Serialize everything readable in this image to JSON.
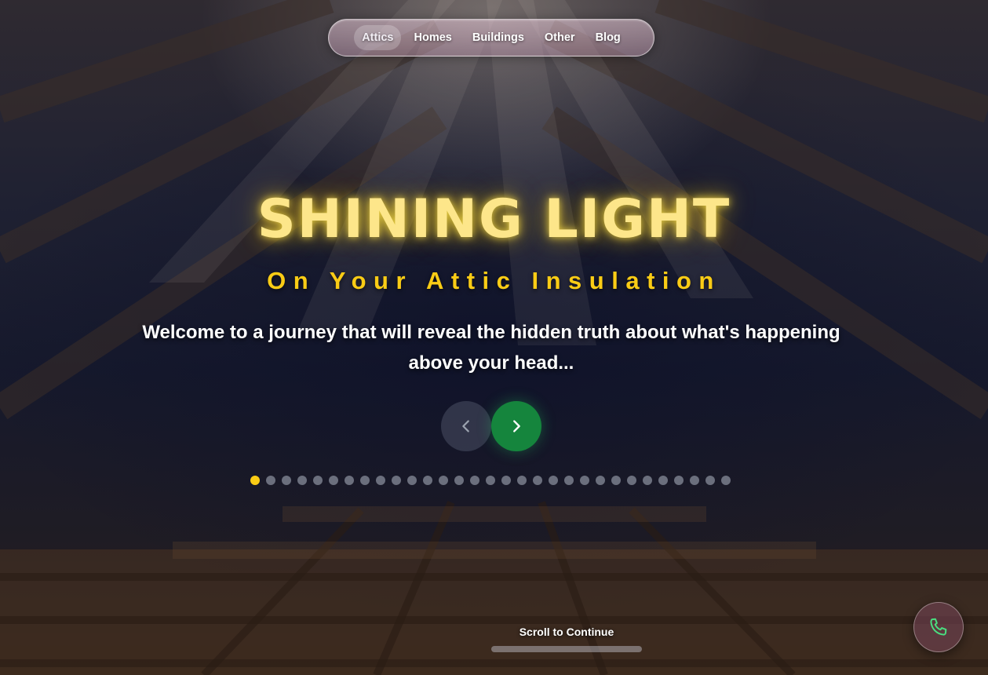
{
  "nav": {
    "items": [
      {
        "label": "Attics",
        "active": true
      },
      {
        "label": "Homes",
        "active": false
      },
      {
        "label": "Buildings",
        "active": false
      },
      {
        "label": "Other",
        "active": false
      },
      {
        "label": "Blog",
        "active": false
      }
    ]
  },
  "hero": {
    "title": "SHINING LIGHT",
    "subtitle": "On Your Attic Insulation",
    "text": "Welcome to a journey that will reveal the hidden truth about what's happening above your head...",
    "slide_current": 1,
    "slide_total": 31
  },
  "icons": {
    "prev": "chevron-left-icon",
    "next": "chevron-right-icon",
    "phone": "phone-icon"
  },
  "colors": {
    "title_glow": "#fde68a",
    "subtitle": "#facc15",
    "next_button": "#15853d",
    "dot_active": "#facc15",
    "dot_inactive": "#6b6f7d",
    "phone_icon": "#4ade80"
  },
  "footer": {
    "scroll_label": "Scroll to Continue"
  }
}
